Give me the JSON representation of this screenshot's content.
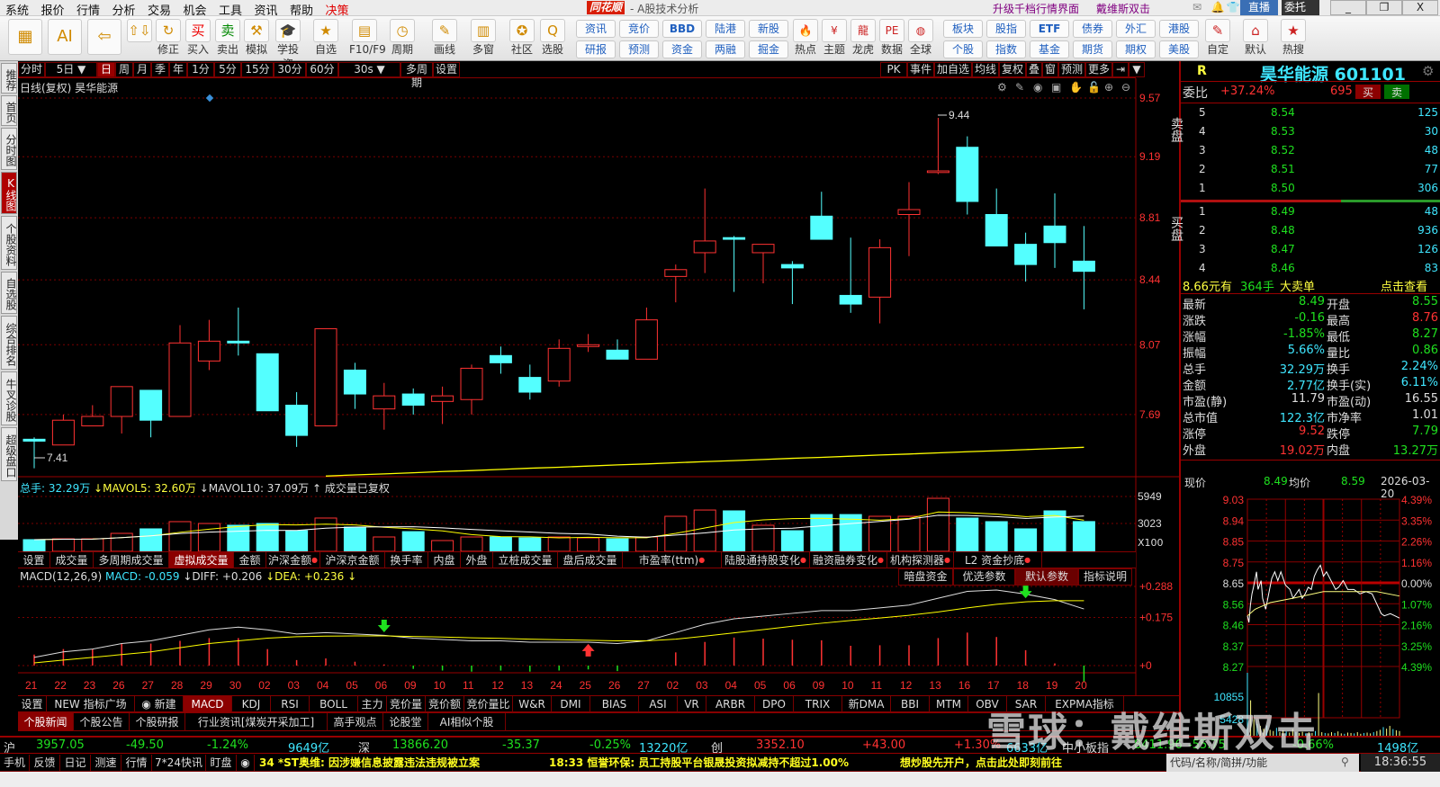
{
  "menu": [
    "系统",
    "报价",
    "行情",
    "分析",
    "交易",
    "机会",
    "工具",
    "资讯",
    "帮助",
    "决策"
  ],
  "app": {
    "logo": "同花顺",
    "title": "- A股技术分析",
    "upgrade": "升级千档行情界面",
    "user": "戴维斯双击",
    "live": "直播",
    "entrust": "委托"
  },
  "toolbar": {
    "icons": [
      {
        "label": "",
        "icon": "▦"
      },
      {
        "label": "",
        "icon": "AI"
      },
      {
        "label": "",
        "icon": "⇦"
      },
      {
        "label": "",
        "icon": "⇧⇩"
      },
      {
        "label": "修正",
        "icon": "↻"
      },
      {
        "label": "买入",
        "icon": "买"
      },
      {
        "label": "卖出",
        "icon": "卖"
      },
      {
        "label": "模拟",
        "icon": "⚒"
      },
      {
        "label": "学投资",
        "icon": "🎓"
      },
      {
        "label": "自选",
        "icon": "★"
      },
      {
        "label": "F10/F9",
        "icon": "▤"
      },
      {
        "label": "周期",
        "icon": "◷"
      },
      {
        "label": "画线",
        "icon": "✎"
      },
      {
        "label": "多窗",
        "icon": "▥"
      },
      {
        "label": "社区",
        "icon": "✪"
      },
      {
        "label": "选股",
        "icon": "Q"
      }
    ],
    "grid1": [
      [
        "资讯",
        "研报"
      ],
      [
        "竞价",
        "预测"
      ],
      [
        "BBD",
        "资金"
      ],
      [
        "陆港",
        "两融"
      ],
      [
        "新股",
        "掘金"
      ]
    ],
    "icons2": [
      {
        "label": "热点",
        "icon": "🔥"
      },
      {
        "label": "主题",
        "icon": "¥"
      },
      {
        "label": "龙虎",
        "icon": "龍"
      },
      {
        "label": "数据",
        "icon": "PE"
      },
      {
        "label": "全球",
        "icon": "◍"
      }
    ],
    "grid2": [
      [
        "板块",
        "个股"
      ],
      [
        "股指",
        "指数"
      ],
      [
        "ETF",
        "基金"
      ],
      [
        "债券",
        "期货"
      ],
      [
        "外汇",
        "期权"
      ],
      [
        "港股",
        "美股"
      ]
    ],
    "icons3": [
      {
        "label": "自定",
        "icon": "✎"
      },
      {
        "label": "默认",
        "icon": "⌂"
      },
      {
        "label": "热搜",
        "icon": "★"
      }
    ]
  },
  "left_tabs": [
    "推荐",
    "首页",
    "分时图",
    "K线图",
    "个股资料",
    "自选股",
    "综合排名",
    "牛叉诊股",
    "超级盘口"
  ],
  "periods": [
    "分时",
    "5日 ▼",
    "日",
    "周",
    "月",
    "季",
    "年",
    "1分",
    "5分",
    "15分",
    "30分",
    "60分",
    "30s ▼",
    "多周期",
    "设置"
  ],
  "period_active": "日",
  "chart_tools": [
    "PK",
    "事件",
    "加自选",
    "均线",
    "复权",
    "叠",
    "窗",
    "预测",
    "更多",
    "⇥",
    "▼"
  ],
  "chart_header": "日线(复权)  昊华能源",
  "chart_data": {
    "type": "candlestick",
    "dates": [
      "21",
      "22",
      "23",
      "26",
      "27",
      "28",
      "29",
      "30",
      "02",
      "03",
      "04",
      "05",
      "06",
      "09",
      "10",
      "11",
      "12",
      "13",
      "24",
      "25",
      "26",
      "27",
      "02",
      "03",
      "04",
      "05",
      "06",
      "09",
      "10",
      "11",
      "12",
      "13",
      "16",
      "17",
      "18",
      "19",
      "20"
    ],
    "ohlc": [
      [
        7.56,
        7.57,
        7.41,
        7.55
      ],
      [
        7.53,
        7.69,
        7.53,
        7.66
      ],
      [
        7.63,
        7.74,
        7.63,
        7.68
      ],
      [
        7.68,
        7.84,
        7.59,
        7.84
      ],
      [
        7.82,
        7.82,
        7.57,
        7.66
      ],
      [
        7.68,
        8.18,
        7.68,
        8.08
      ],
      [
        7.98,
        8.21,
        7.93,
        8.09
      ],
      [
        8.09,
        8.28,
        8.01,
        8.08
      ],
      [
        8.02,
        8.02,
        7.71,
        7.71
      ],
      [
        7.74,
        7.81,
        7.52,
        7.58
      ],
      [
        7.63,
        8.16,
        7.63,
        8.16
      ],
      [
        7.93,
        7.97,
        7.72,
        7.8
      ],
      [
        7.72,
        7.86,
        7.61,
        7.79
      ],
      [
        7.8,
        7.83,
        7.69,
        7.74
      ],
      [
        7.76,
        7.84,
        7.64,
        7.79
      ],
      [
        7.77,
        7.96,
        7.69,
        7.94
      ],
      [
        8.01,
        8.06,
        7.91,
        7.97
      ],
      [
        7.89,
        7.96,
        7.77,
        7.81
      ],
      [
        7.87,
        8.1,
        7.84,
        8.05
      ],
      [
        8.06,
        8.13,
        8.03,
        8.07
      ],
      [
        8.04,
        8.1,
        7.99,
        7.99
      ],
      [
        7.99,
        8.28,
        7.99,
        8.21
      ],
      [
        8.46,
        8.53,
        8.31,
        8.5
      ],
      [
        8.6,
        8.99,
        8.48,
        8.67
      ],
      [
        8.69,
        8.7,
        8.37,
        8.68
      ],
      [
        8.6,
        8.65,
        8.42,
        8.65
      ],
      [
        8.53,
        8.55,
        8.3,
        8.51
      ],
      [
        8.82,
        8.97,
        8.68,
        8.68
      ],
      [
        8.35,
        8.69,
        8.25,
        8.3
      ],
      [
        8.34,
        8.68,
        8.19,
        8.63
      ],
      [
        8.83,
        9.03,
        8.58,
        8.86
      ],
      [
        9.09,
        9.44,
        9.08,
        9.1
      ],
      [
        9.25,
        9.32,
        8.83,
        8.91
      ],
      [
        8.83,
        8.99,
        8.64,
        8.64
      ],
      [
        8.65,
        8.72,
        8.43,
        8.53
      ],
      [
        8.76,
        8.96,
        8.51,
        8.66
      ],
      [
        8.55,
        8.76,
        8.27,
        8.49
      ]
    ],
    "price_ticks": [
      9.57,
      9.19,
      8.81,
      8.44,
      8.07,
      7.69
    ],
    "annotations": {
      "high": "9.44",
      "low": "7.41"
    },
    "ma_long_start": 10,
    "ma_long": [
      7.37,
      7.376,
      7.381,
      7.387,
      7.393,
      7.398,
      7.404,
      7.41,
      7.415,
      7.421,
      7.427,
      7.432,
      7.438,
      7.444,
      7.449,
      7.455,
      7.461,
      7.466,
      7.472,
      7.478,
      7.483,
      7.489,
      7.495,
      7.5,
      7.506,
      7.512,
      7.518
    ],
    "volume": [
      1270,
      1360,
      1360,
      1950,
      2440,
      3220,
      3020,
      2830,
      3020,
      2240,
      3610,
      2630,
      1560,
      2140,
      1170,
      1560,
      1560,
      1460,
      1560,
      1460,
      1360,
      1560,
      3800,
      4480,
      4390,
      2830,
      2240,
      3990,
      3990,
      3800,
      3800,
      5750,
      3610,
      3220,
      2440,
      4390,
      3229
    ],
    "volume_ticks": [
      5949,
      3023
    ],
    "volume_unit": "X100",
    "volume_legend": {
      "total": "总手: 32.29万",
      "mavol5": "↓MAVOL5: 32.60万",
      "mavol10": "↓MAVOL10: 37.09万",
      "note": "↑ 成交量已复权"
    },
    "diff": [
      0.03,
      0.05,
      0.06,
      0.08,
      0.09,
      0.11,
      0.13,
      0.14,
      0.13,
      0.115,
      0.12,
      0.115,
      0.11,
      0.1,
      0.095,
      0.09,
      0.09,
      0.085,
      0.085,
      0.085,
      0.08,
      0.09,
      0.12,
      0.15,
      0.17,
      0.18,
      0.19,
      0.2,
      0.2,
      0.21,
      0.22,
      0.245,
      0.27,
      0.275,
      0.26,
      0.24,
      0.206
    ],
    "dea": [
      0.01,
      0.02,
      0.03,
      0.04,
      0.05,
      0.065,
      0.08,
      0.09,
      0.1,
      0.105,
      0.107,
      0.108,
      0.108,
      0.106,
      0.104,
      0.101,
      0.099,
      0.096,
      0.094,
      0.092,
      0.09,
      0.09,
      0.096,
      0.107,
      0.119,
      0.131,
      0.143,
      0.154,
      0.164,
      0.173,
      0.183,
      0.195,
      0.21,
      0.223,
      0.232,
      0.236,
      0.236
    ],
    "macd_ticks": [
      "+0.288",
      "+0.175",
      "+0"
    ],
    "signals": [
      {
        "index": 12,
        "type": "sell"
      },
      {
        "index": 19,
        "type": "buy"
      },
      {
        "index": 34,
        "type": "sell"
      }
    ]
  },
  "vol_tabs": [
    "设置",
    "成交量",
    "多周期成交量",
    "虚拟成交量",
    "金额",
    "沪深金额",
    "沪深京金额",
    "换手率",
    "内盘",
    "外盘",
    "立桩成交量",
    "盘后成交量",
    "市盈率(ttm)",
    "陆股通持股变化",
    "融资融券变化",
    "机构探测器",
    "L2 资金抄底"
  ],
  "vol_tab_active": "虚拟成交量",
  "macd_header": {
    "name": "MACD(12,26,9)",
    "macd": "MACD: -0.059",
    "diff": "↓DIFF: +0.206",
    "dea": "↓DEA: +0.236 ↓"
  },
  "macd_buttons": [
    "暗盘资金",
    "优选参数",
    "默认参数",
    "指标说明"
  ],
  "indicator_tabs": [
    "设置",
    "NEW 指标广场",
    "◉ 新建",
    "MACD",
    "KDJ",
    "RSI",
    "BOLL",
    "主力",
    "竞价量",
    "竞价额",
    "竞价量比",
    "W&R",
    "DMI",
    "BIAS",
    "ASI",
    "VR",
    "ARBR",
    "DPO",
    "TRIX",
    "新DMA",
    "BBI",
    "MTM",
    "OBV",
    "SAR",
    "EXPMA指标"
  ],
  "news_tabs": [
    "个股新闻",
    "个股公告",
    "个股研报",
    "行业资讯[煤炭开采加工]",
    "高手观点",
    "论股堂",
    "AI相似个股"
  ],
  "quote": {
    "flag": "R",
    "name": "昊华能源 601101",
    "weibi_label": "委比",
    "weibi": "+37.24%",
    "weicha": "695",
    "buy_btn": "买",
    "sell_btn": "卖",
    "sell_label": "卖盘",
    "buy_label": "买盘",
    "sells": [
      [
        "5",
        "8.54",
        "125"
      ],
      [
        "4",
        "8.53",
        "30"
      ],
      [
        "3",
        "8.52",
        "48"
      ],
      [
        "2",
        "8.51",
        "77"
      ],
      [
        "1",
        "8.50",
        "306"
      ]
    ],
    "buys": [
      [
        "1",
        "8.49",
        "48"
      ],
      [
        "2",
        "8.48",
        "936"
      ],
      [
        "3",
        "8.47",
        "126"
      ],
      [
        "4",
        "8.46",
        "83"
      ]
    ],
    "big_order": {
      "price": "8.66元有",
      "qty": "364手",
      "type": "大卖单",
      "link": "点击查看"
    },
    "stats": [
      [
        "最新",
        "8.49",
        "grn",
        "开盘",
        "8.55",
        "grn"
      ],
      [
        "涨跌",
        "-0.16",
        "grn",
        "最高",
        "8.76",
        "red"
      ],
      [
        "涨幅",
        "-1.85%",
        "grn",
        "最低",
        "8.27",
        "grn"
      ],
      [
        "振幅",
        "5.66%",
        "cyn",
        "量比",
        "0.86",
        "grn"
      ],
      [
        "总手",
        "32.29万",
        "cyn",
        "换手",
        "2.24%",
        "cyn"
      ],
      [
        "金额",
        "2.77亿",
        "cyn",
        "换手(实)",
        "6.11%",
        "cyn"
      ],
      [
        "市盈(静)",
        "11.79",
        "wht",
        "市盈(动)",
        "16.55",
        "wht"
      ],
      [
        "总市值",
        "122.3亿",
        "cyn",
        "市净率",
        "1.01",
        "wht"
      ],
      [
        "涨停",
        "9.52",
        "red",
        "跌停",
        "7.79",
        "grn"
      ],
      [
        "外盘",
        "19.02万",
        "red",
        "内盘",
        "13.27万",
        "grn"
      ]
    ]
  },
  "intraday": {
    "header": {
      "price_label": "现价",
      "price": "8.49",
      "avg_label": "均价",
      "avg": "8.59",
      "date": "2026-03-20"
    },
    "price_ticks": [
      "9.03",
      "8.94",
      "8.85",
      "8.75",
      "8.65",
      "8.56",
      "8.46",
      "8.37",
      "8.27"
    ],
    "pct_ticks": [
      "4.39%",
      "3.35%",
      "2.26%",
      "1.16%",
      "0.00%",
      "1.07%",
      "2.16%",
      "3.25%",
      "4.39%"
    ],
    "vol_ticks": [
      "10855",
      "5428"
    ],
    "prev_close": 8.65,
    "range": [
      8.27,
      9.03
    ],
    "price": [
      [
        0,
        8.5
      ],
      [
        0.01,
        8.47
      ],
      [
        0.02,
        8.55
      ],
      [
        0.03,
        8.6
      ],
      [
        0.04,
        8.63
      ],
      [
        0.06,
        8.7
      ],
      [
        0.07,
        8.62
      ],
      [
        0.09,
        8.66
      ],
      [
        0.1,
        8.58
      ],
      [
        0.12,
        8.53
      ],
      [
        0.14,
        8.6
      ],
      [
        0.16,
        8.67
      ],
      [
        0.18,
        8.7
      ],
      [
        0.2,
        8.66
      ],
      [
        0.22,
        8.7
      ],
      [
        0.25,
        8.64
      ],
      [
        0.28,
        8.62
      ],
      [
        0.3,
        8.58
      ],
      [
        0.34,
        8.62
      ],
      [
        0.36,
        8.58
      ],
      [
        0.38,
        8.6
      ],
      [
        0.4,
        8.63
      ],
      [
        0.42,
        8.62
      ],
      [
        0.44,
        8.68
      ],
      [
        0.46,
        8.71
      ],
      [
        0.48,
        8.73
      ],
      [
        0.5,
        8.68
      ],
      [
        0.52,
        8.7
      ],
      [
        0.55,
        8.66
      ],
      [
        0.58,
        8.62
      ],
      [
        0.6,
        8.63
      ],
      [
        0.63,
        8.66
      ],
      [
        0.66,
        8.62
      ],
      [
        0.7,
        8.62
      ],
      [
        0.74,
        8.6
      ],
      [
        0.78,
        8.61
      ],
      [
        0.82,
        8.6
      ],
      [
        0.84,
        8.57
      ],
      [
        0.88,
        8.51
      ],
      [
        0.9,
        8.5
      ],
      [
        0.94,
        8.51
      ],
      [
        0.97,
        8.5
      ],
      [
        1,
        8.49
      ]
    ],
    "avg": [
      [
        0,
        8.5
      ],
      [
        0.05,
        8.53
      ],
      [
        0.15,
        8.56
      ],
      [
        0.3,
        8.58
      ],
      [
        0.5,
        8.61
      ],
      [
        0.85,
        8.61
      ],
      [
        1,
        8.59
      ]
    ],
    "volume": [
      16000,
      9000,
      4200,
      3000,
      2500,
      1800,
      2600,
      1500,
      1200,
      2000,
      900,
      1400,
      1100,
      800,
      1700,
      900,
      700,
      1000,
      600,
      900,
      700,
      1200,
      10855,
      900,
      700,
      600,
      900,
      700,
      1100,
      600,
      500,
      800,
      700,
      600,
      900,
      500,
      700,
      800,
      600,
      900,
      1200,
      1500,
      2200,
      1800,
      2500,
      1700,
      1400,
      1200
    ]
  },
  "indices": [
    {
      "name": "沪",
      "value": "3957.05",
      "chg": "-49.50",
      "pct": "-1.24%",
      "amt": "9649亿",
      "c": "grn"
    },
    {
      "name": "深",
      "value": "13866.20",
      "chg": "-35.37",
      "pct": "-0.25%",
      "amt": "13220亿",
      "c": "grn"
    },
    {
      "name": "创",
      "value": "3352.10",
      "chg": "+43.00",
      "pct": "+1.30%",
      "amt": "6633亿",
      "c": "red"
    },
    {
      "name": "中小板指",
      "value": "8411.96",
      "chg": "-55.75",
      "pct": "-0.66%",
      "amt": "1498亿",
      "c": "grn"
    }
  ],
  "bottom_tabs": [
    "手机端",
    "反馈",
    "日记",
    "测速",
    "行情",
    "7*24快讯",
    "盯盘",
    "◉"
  ],
  "news": [
    "34 *ST奥维: 因涉嫌信息披露违法违规被立案",
    "18:33 恒誉环保: 员工持股平台银晟投资拟减持不超过1.00%",
    "想炒股先开户，点击此处即刻前往"
  ],
  "search_placeholder": "代码/名称/简拼/功能",
  "clock": "18:36:55",
  "watermark": "雪球：戴维斯双击",
  "colors": {
    "up": "#ff3232",
    "down": "#54ffff",
    "grid": "#7a0000",
    "ma": "#ffff00",
    "diff": "#ffffff"
  }
}
